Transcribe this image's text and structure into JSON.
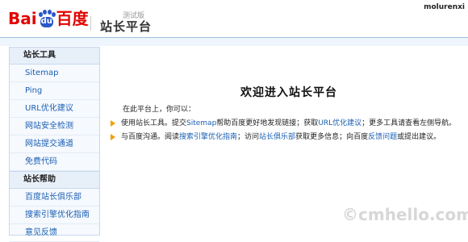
{
  "header": {
    "logo_bai": "Bai",
    "logo_du": "du",
    "logo_wordmark": "百度",
    "beta_label": "测试版",
    "site_title": "站长平台",
    "username": "molurenxi"
  },
  "sidebar": {
    "section_tools": "站长工具",
    "tools": [
      "Sitemap",
      "Ping",
      "URL优化建议",
      "网站安全检测",
      "网站提交通道",
      "免费代码"
    ],
    "section_help": "站长帮助",
    "help": [
      "百度站长俱乐部",
      "搜索引擎优化指南",
      "意见反馈"
    ]
  },
  "main": {
    "title": "欢迎进入站长平台",
    "intro": "在此平台上，你可以：",
    "bullet1": {
      "prefix": "使用站长工具。提交",
      "link_sitemap": "Sitemap",
      "middle": "帮助百度更好地发现链接；获取",
      "link_url": "URL优化建议",
      "suffix": "；更多工具请查看左侧导航。"
    },
    "bullet2": {
      "prefix": "与百度沟通。阅读",
      "link_guide": "搜索引擎优化指南",
      "middle1": "；访问",
      "link_club": "站长俱乐部",
      "middle2": "获取更多信息；向百度",
      "link_feedback": "反馈问题",
      "suffix": "或提出建议。"
    }
  },
  "watermark": "©cmhello.com",
  "colors": {
    "brand_red": "#e10602",
    "brand_blue": "#2b58c8",
    "link_blue": "#1a5fb4",
    "bullet_orange": "#f0a000"
  }
}
